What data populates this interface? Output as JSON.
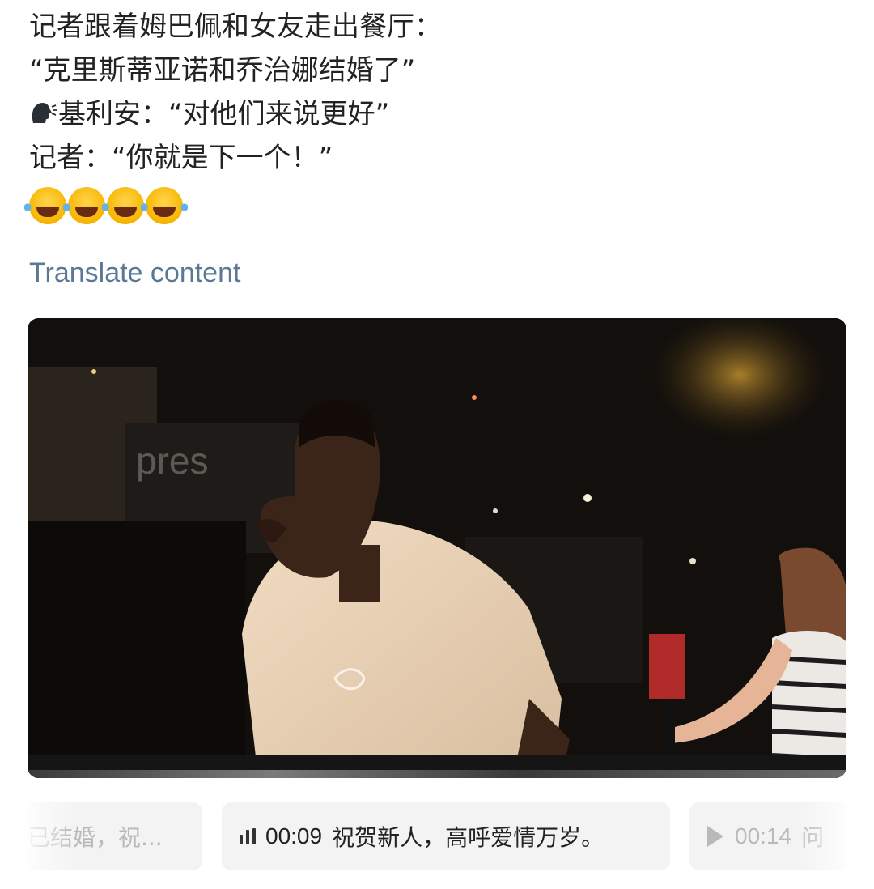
{
  "post": {
    "lines": [
      "记者跟着姆巴佩和女友走出餐厅：",
      "“克里斯蒂亚诺和乔治娜结婚了”",
      "基利安：“对他们来说更好”",
      "记者：“你就是下一个！”"
    ],
    "emoji_name": "face-with-tears-of-joy",
    "emoji_count": 4,
    "speaker_icon": "speaking-head-icon"
  },
  "translate": {
    "label": "Translate content"
  },
  "video": {
    "thumbnail_alt": "Night street video frame",
    "overlay_text": "pres"
  },
  "captions": {
    "previous": {
      "text": "已结婚，祝..."
    },
    "current": {
      "time": "00:09",
      "text": "祝贺新人，高呼爱情万岁。",
      "icon": "audio-bars-icon"
    },
    "next": {
      "time": "00:14",
      "text": "问",
      "icon": "play-icon"
    }
  }
}
